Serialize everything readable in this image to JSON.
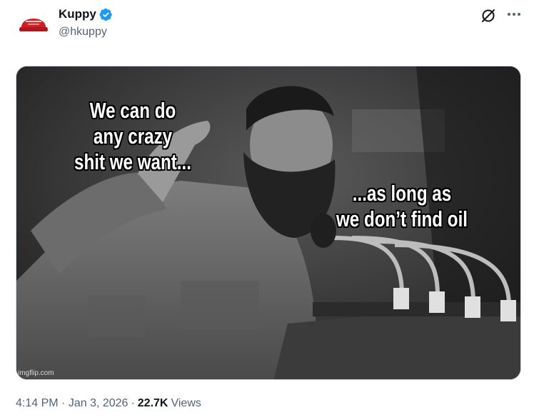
{
  "author": {
    "name": "Kuppy",
    "handle": "@hkuppy",
    "avatar_text": "MAKE AMERICA"
  },
  "media": {
    "caption_left": "We can do\nany crazy\nshit we want...",
    "caption_right": "...as long as\nwe don’t find oil",
    "watermark": "imgflip.com"
  },
  "meta": {
    "time": "4:14 PM",
    "date": "Jan 3, 2026",
    "separator": "·",
    "views_count": "22.7K",
    "views_label": "Views"
  },
  "colors": {
    "text_primary": "#0f1419",
    "text_secondary": "#536471",
    "verified_blue": "#1d9bf0",
    "avatar_red": "#d21f26"
  },
  "icons": {
    "verified": "verified-badge-icon",
    "grok": "grok-icon",
    "more": "more-icon"
  }
}
